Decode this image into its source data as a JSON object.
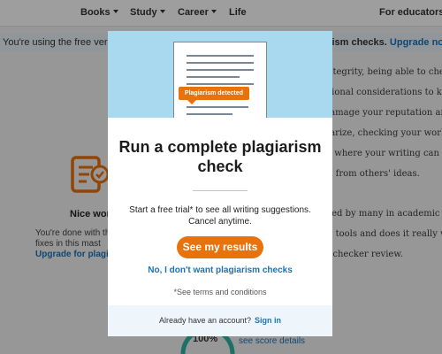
{
  "nav": {
    "items": [
      {
        "label": "Books",
        "dropdown": true
      },
      {
        "label": "Study",
        "dropdown": true
      },
      {
        "label": "Career",
        "dropdown": true
      },
      {
        "label": "Life",
        "dropdown": false
      }
    ],
    "right_link": "For educators"
  },
  "notice": {
    "left_text": "You're using the free version",
    "right_text": "iarism checks.",
    "upgrade_label": "Upgrade now"
  },
  "background_article": {
    "lines": [
      "ntegrity, being able to check",
      "sional considerations to kee",
      "lamage your reputation and",
      "iarize, checking your work r",
      "s where your writing can im",
      "n from others' ideas.",
      "sed by many in academic is",
      "g tools and does it really wo",
      ". checker review."
    ]
  },
  "left_panel": {
    "title": "Nice wor",
    "line1": "You're done with th",
    "line2": "fixes in this mast",
    "upgrade_link": "Upgrade for plagiar"
  },
  "score": {
    "percent": "100%",
    "link": "see score details",
    "accent_color": "#2fb5a3"
  },
  "modal": {
    "hero_badge": "Plagiarism detected",
    "title": "Run a complete plagiarism check",
    "description": "Start a free trial* to see all writing suggestions. Cancel anytime.",
    "cta_label": "See my results",
    "decline_label": "No, I don't want plagiarism checks",
    "terms": "*See terms and conditions",
    "footer_text": "Already have an account?",
    "signin_label": "Sign in"
  },
  "colors": {
    "accent_orange": "#e8720c",
    "link_blue": "#1a73b8",
    "hero_blue": "#a9d9ef"
  }
}
